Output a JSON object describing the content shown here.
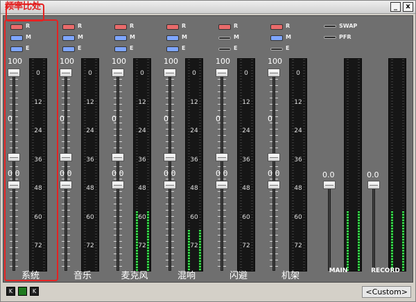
{
  "window": {
    "title": "频率比处",
    "minimize_label": "_",
    "close_label": "x"
  },
  "scale": [
    "0",
    "12",
    "24",
    "36",
    "48",
    "60",
    "72"
  ],
  "channels": [
    {
      "name": "系统",
      "leds": [
        "on",
        "on",
        "on"
      ],
      "top_value": "100",
      "mid_value": "0",
      "low_value": "0.0",
      "meter_level": 0.0,
      "highlighted": true
    },
    {
      "name": "音乐",
      "leds": [
        "on",
        "on",
        "on"
      ],
      "top_value": "100",
      "mid_value": "0",
      "low_value": "0.0",
      "meter_level": 0.0,
      "highlighted": false
    },
    {
      "name": "麦克风",
      "leds": [
        "on",
        "on",
        "on"
      ],
      "top_value": "100",
      "mid_value": "0",
      "low_value": "0.0",
      "meter_level": 0.28,
      "highlighted": false
    },
    {
      "name": "混响",
      "leds": [
        "on",
        "on",
        "on"
      ],
      "top_value": "100",
      "mid_value": "0",
      "low_value": "0.0",
      "meter_level": 0.19,
      "highlighted": false
    },
    {
      "name": "闪避",
      "leds": [
        "on",
        "off",
        "off"
      ],
      "top_value": "100",
      "mid_value": "0",
      "low_value": "0.0",
      "meter_level": 0.0,
      "highlighted": false
    },
    {
      "name": "机架",
      "leds": [
        "on",
        "on",
        "off"
      ],
      "top_value": "100",
      "mid_value": "0",
      "low_value": "0.0",
      "meter_level": 0.0,
      "highlighted": false
    }
  ],
  "led_labels": [
    "R",
    "M",
    "E"
  ],
  "master": {
    "swap_label": "SWAP",
    "pfr_label": "PFR",
    "main_label": "MAIN",
    "record_label": "RECORD",
    "main_value": "0.0",
    "record_value": "0.0",
    "main_meter_level": 0.28,
    "record_meter_level": 0.28
  },
  "bottom": {
    "preset_label": "<Custom>",
    "nav_prev": "K",
    "nav_next": "K"
  },
  "colors": {
    "title": "#e02020",
    "highlight": "#e52222",
    "meter_active": "#3de052",
    "led_red": "#e96a6a",
    "led_blue": "#7fa6ff"
  }
}
